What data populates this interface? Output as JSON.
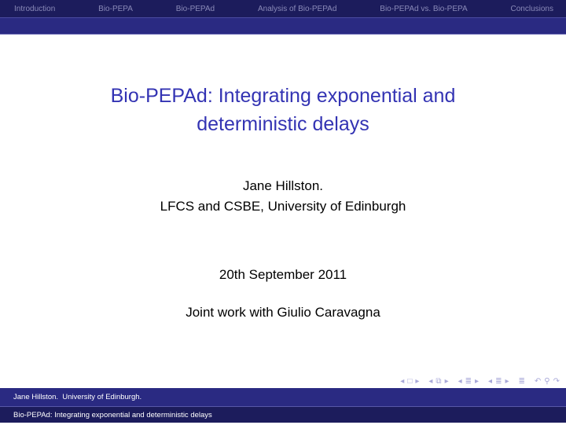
{
  "nav": {
    "sections": [
      "Introduction",
      "Bio-PEPA",
      "Bio-PEPAd",
      "Analysis of Bio-PEPAd",
      "Bio-PEPAd vs. Bio-PEPA",
      "Conclusions"
    ]
  },
  "slide": {
    "title_line1": "Bio-PEPAd: Integrating exponential and",
    "title_line2": "deterministic delays",
    "author": "Jane Hillston.",
    "affiliation": "LFCS and CSBE, University of Edinburgh",
    "date": "20th September 2011",
    "joint_work": "Joint work with Giulio Caravagna"
  },
  "beamer_nav": {
    "icons": [
      "prev-arrow-icon",
      "frame-icon",
      "next-arrow-icon",
      "prev-arrow-icon",
      "subsection-icon",
      "next-arrow-icon",
      "prev-arrow-icon",
      "section-icon",
      "next-arrow-icon",
      "prev-arrow-icon",
      "section-icon",
      "next-arrow-icon",
      "presentation-icon",
      "undo-icon",
      "search-icon",
      "redo-icon"
    ]
  },
  "footer": {
    "author_line": "Jane Hillston.  University of Edinburgh.",
    "title_line": "Bio-PEPAd: Integrating exponential and deterministic delays"
  },
  "colors": {
    "nav_dark": "#1c1c5c",
    "nav_mid": "#2a2a82",
    "title_blue": "#3333b3",
    "nav_text": "#8a8ab8"
  }
}
